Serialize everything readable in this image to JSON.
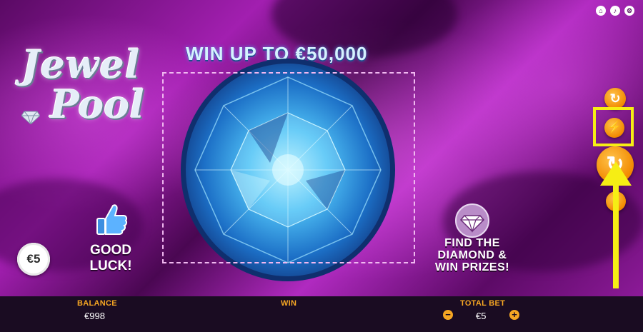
{
  "top_icons": {
    "home": "⌂",
    "sound": "♪",
    "settings": "⚙"
  },
  "logo": {
    "line1": "Jewel",
    "line2": "Pool"
  },
  "headline": "WIN UP TO €50,000",
  "good_luck": {
    "line1": "GOOD",
    "line2": "LUCK!"
  },
  "chip_value": "€5",
  "find_text": {
    "line1": "FIND THE",
    "line2": "DIAMOND &",
    "line3": "WIN PRIZES!"
  },
  "side_buttons": {
    "autoplay": "↻",
    "turbo": "⚡",
    "play": "↻",
    "bet": "€"
  },
  "bottom_bar": {
    "balance_label": "BALANCE",
    "balance_value": "€998",
    "win_label": "WIN",
    "total_bet_label": "TOTAL BET",
    "total_bet_value": "€5",
    "minus": "−",
    "plus": "+"
  },
  "colors": {
    "accent_orange": "#f5a623",
    "highlight_yellow": "#f6ee14",
    "diamond_blue": "#3aa8f0",
    "background_purple": "#a21fb0"
  }
}
